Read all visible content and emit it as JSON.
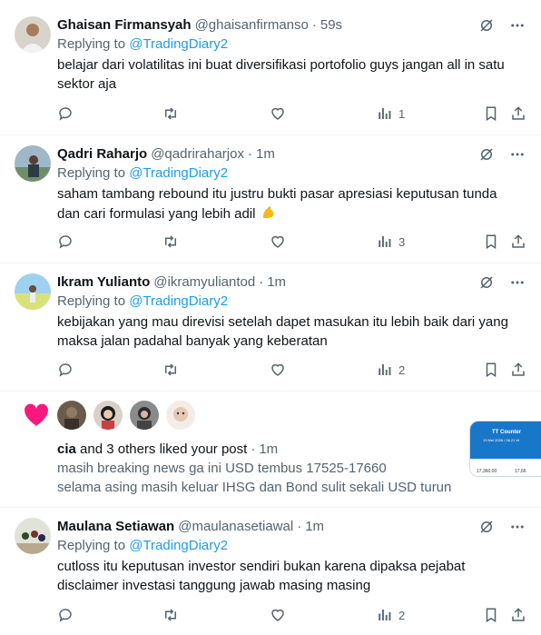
{
  "colors": {
    "accent": "#1d9bf0",
    "secondary_text": "#536471",
    "like": "#f91880"
  },
  "tweets": [
    {
      "name": "Ghaisan Firmansyah",
      "handle": "@ghaisanfirmanso",
      "time": "59s",
      "replying_prefix": "Replying to ",
      "replying_to": "@TradingDiary2",
      "text_lines": [
        "belajar dari volatilitas ini buat diversifikasi portofolio guys jangan all in satu",
        "sektor aja"
      ],
      "views": "1"
    },
    {
      "name": "Qadri Raharjo",
      "handle": "@qadriraharjox",
      "time": "1m",
      "replying_prefix": "Replying to ",
      "replying_to": "@TradingDiary2",
      "text_lines": [
        "saham tambang rebound itu justru bukti pasar apresiasi keputusan tunda",
        "dan cari formulasi yang lebih adil"
      ],
      "emoji": "flexed-biceps",
      "views": "3"
    },
    {
      "name": "Ikram Yulianto",
      "handle": "@ikramyuliantod",
      "time": "1m",
      "replying_prefix": "Replying to ",
      "replying_to": "@TradingDiary2",
      "text_lines": [
        "kebijakan yang mau direvisi setelah dapet masukan itu lebih baik dari yang",
        "maksa jalan padahal banyak yang keberatan"
      ],
      "views": "2"
    },
    {
      "name": "Maulana Setiawan",
      "handle": "@maulanasetiawal",
      "time": "1m",
      "replying_prefix": "Replying to ",
      "replying_to": "@TradingDiary2",
      "text_lines": [
        "cutloss itu keputusan investor sendiri bukan karena dipaksa pejabat",
        "disclaimer investasi tanggung jawab masing masing"
      ],
      "views": "2"
    }
  ],
  "notification": {
    "icon": "heart-icon",
    "user": "cia",
    "rest": " and 3 others liked your post",
    "time": "1m",
    "post_lines": [
      "masih breaking news ga ini USD tembus 17525-17660",
      "selama asing masih keluar IHSG dan Bond sulit sekali USD turun"
    ],
    "thumb": {
      "title": "TT Counter",
      "subtitle": "13 Mei 2026 / 06.21 W",
      "val1": "17,360.00",
      "val2": "17,66"
    }
  },
  "dot": "·"
}
